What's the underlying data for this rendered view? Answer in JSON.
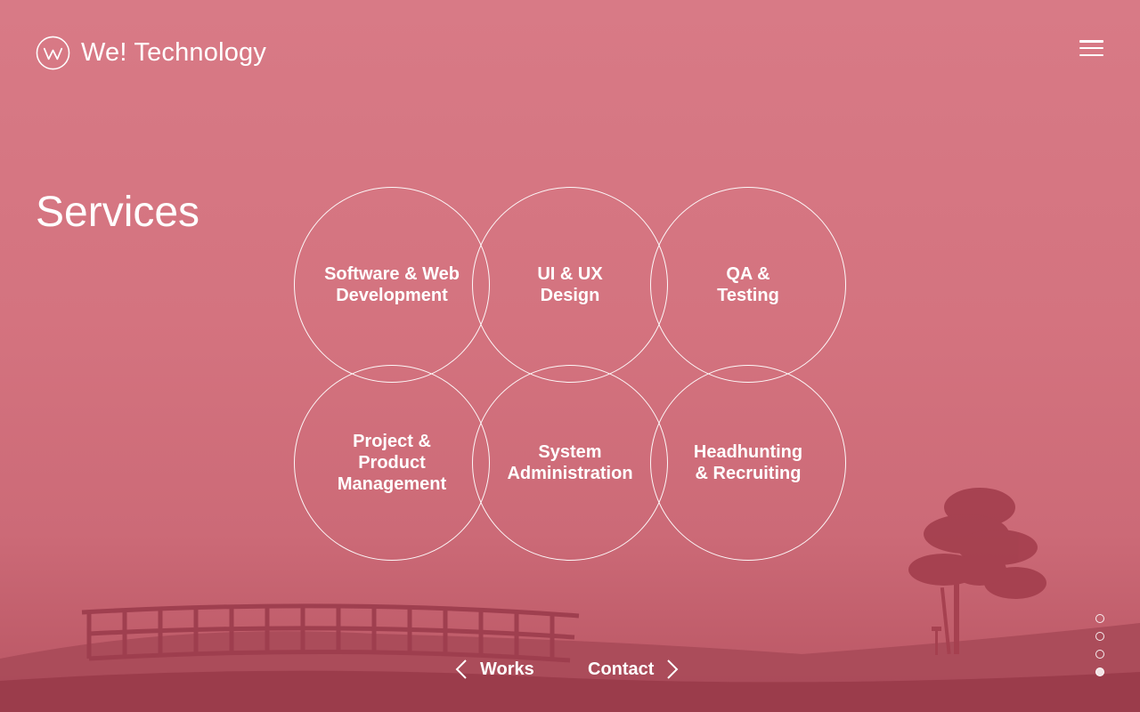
{
  "brand": {
    "name": "We! Technology",
    "logo_icon": "w-circle-logo"
  },
  "header": {
    "menu_icon": "hamburger-menu-icon"
  },
  "page": {
    "title": "Services"
  },
  "services": [
    {
      "label": "Software & Web\nDevelopment"
    },
    {
      "label": "UI & UX\nDesign"
    },
    {
      "label": "QA &\nTesting"
    },
    {
      "label": "Project &\nProduct\nManagement"
    },
    {
      "label": "System\nAdministration"
    },
    {
      "label": "Headhunting\n& Recruiting"
    }
  ],
  "nav": {
    "prev_label": "Works",
    "next_label": "Contact"
  },
  "pagination": {
    "total": 4,
    "active_index": 3
  },
  "colors": {
    "overlay": "#d4737f",
    "text": "#ffffff",
    "scene": "#9e3e4e"
  }
}
